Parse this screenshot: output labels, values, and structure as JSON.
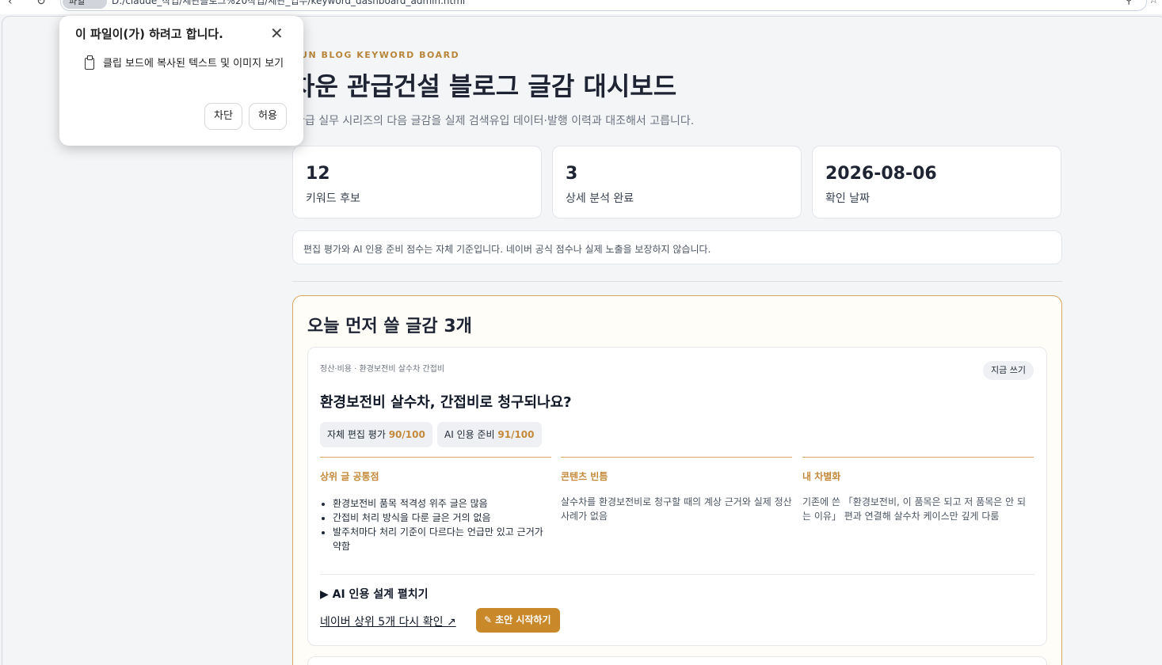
{
  "browser": {
    "back_icon": "arrow-left-icon",
    "reload_icon": "reload-icon",
    "site_info_label": "파일",
    "address": "D:/claude_작업/세관블로그%20작업/세관_업무/keyword_dashboard_admin.html",
    "search_icon": "search-icon",
    "star_icon": "star-icon"
  },
  "permission_popup": {
    "title": "이 파일이(가) 하려고 합니다.",
    "close_icon": "close-icon",
    "clipboard_icon": "clipboard-icon",
    "request_text": "클립 보드에 복사된 텍스트 및 이미지 보기",
    "block_label": "차단",
    "allow_label": "허용"
  },
  "header": {
    "eyebrow": "EUN BLOG KEYWORD BOARD",
    "title": "차운 관급건설 블로그 글감 대시보드",
    "subtitle": "관급 실무 시리즈의 다음 글감을 실제 검색유입 데이터·발행 이력과 대조해서 고릅니다."
  },
  "stats": [
    {
      "value": "12",
      "label": "키워드 후보"
    },
    {
      "value": "3",
      "label": "상세 분석 완료"
    },
    {
      "value": "2026-08-06",
      "label": "확인 날짜"
    }
  ],
  "disclaimer": "편집 평가와 AI 인용 준비 점수는 자체 기준입니다. 네이버 공식 점수나 실제 노출을 보장하지 않습니다.",
  "today": {
    "title": "오늘 먼저 쓸 글감 3개",
    "card": {
      "category": "정산·비용 · 환경보전비 살수차 간접비",
      "badge": "지금 쓰기",
      "title": "환경보전비 살수차, 간접비로 청구되나요?",
      "scores": [
        {
          "label": "자체 편집 평가",
          "value": "90/100"
        },
        {
          "label": "AI 인용 준비",
          "value": "91/100"
        }
      ],
      "columns": {
        "common": {
          "heading": "상위 글 공통점",
          "items": [
            "환경보전비 품목 적격성 위주 글은 많음",
            "간접비 처리 방식을 다룬 글은 거의 없음",
            "발주처마다 처리 기준이 다르다는 언급만 있고 근거가 약함"
          ]
        },
        "gap": {
          "heading": "콘텐츠 빈틈",
          "text": "살수차를 환경보전비로 청구할 때의 계상 근거와 실제 정산 사례가 없음"
        },
        "differentiation": {
          "heading": "내 차별화",
          "text": "기존에 쓴 「환경보전비, 이 품목은 되고 저 품목은 안 되는 이유」 편과 연결해 살수차 케이스만 깊게 다룸"
        }
      },
      "ai_design_toggle": "▶ AI 인용 설계 펼치기",
      "naver_link": "네이버 상위 5개 다시 확인 ↗",
      "start_button": "초안 시작하기",
      "start_icon": "pencil-icon"
    }
  }
}
